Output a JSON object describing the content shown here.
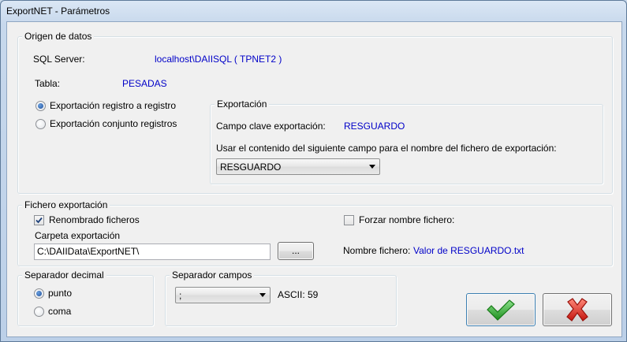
{
  "window": {
    "title": "ExportNET - Parámetros"
  },
  "origen": {
    "legend": "Origen de datos",
    "sql_server_label": "SQL Server:",
    "sql_server_value": "localhost\\DAIISQL ( TPNET2 )",
    "tabla_label": "Tabla:",
    "tabla_value": "PESADAS",
    "radio_registro": "Exportación registro a registro",
    "radio_conjunto": "Exportación conjunto registros",
    "selected_mode": "registro",
    "exportacion": {
      "legend": "Exportación",
      "campo_clave_label": "Campo clave exportación:",
      "campo_clave_value": "RESGUARDO",
      "usar_label": "Usar el contenido del siguiente campo para el nombre del fichero de exportación:",
      "campo_select_value": "RESGUARDO"
    }
  },
  "fichero": {
    "legend": "Fichero exportación",
    "renombrado_label": "Renombrado ficheros",
    "renombrado_checked": true,
    "forzar_label": "Forzar nombre fichero:",
    "forzar_checked": false,
    "carpeta_label": "Carpeta exportación",
    "carpeta_value": "C:\\DAIIData\\ExportNET\\",
    "browse_label": "...",
    "nombre_label": "Nombre fichero:",
    "nombre_value": "Valor de RESGUARDO.txt"
  },
  "separador_decimal": {
    "legend": "Separador decimal",
    "punto_label": "punto",
    "coma_label": "coma",
    "selected": "punto"
  },
  "separador_campos": {
    "legend": "Separador campos",
    "select_value": ";",
    "ascii_text": "ASCII: 59"
  },
  "actions": {
    "accept_icon": "check-icon",
    "cancel_icon": "x-icon",
    "accent_ok": "#2aa52a",
    "accent_cancel": "#d8221b"
  }
}
